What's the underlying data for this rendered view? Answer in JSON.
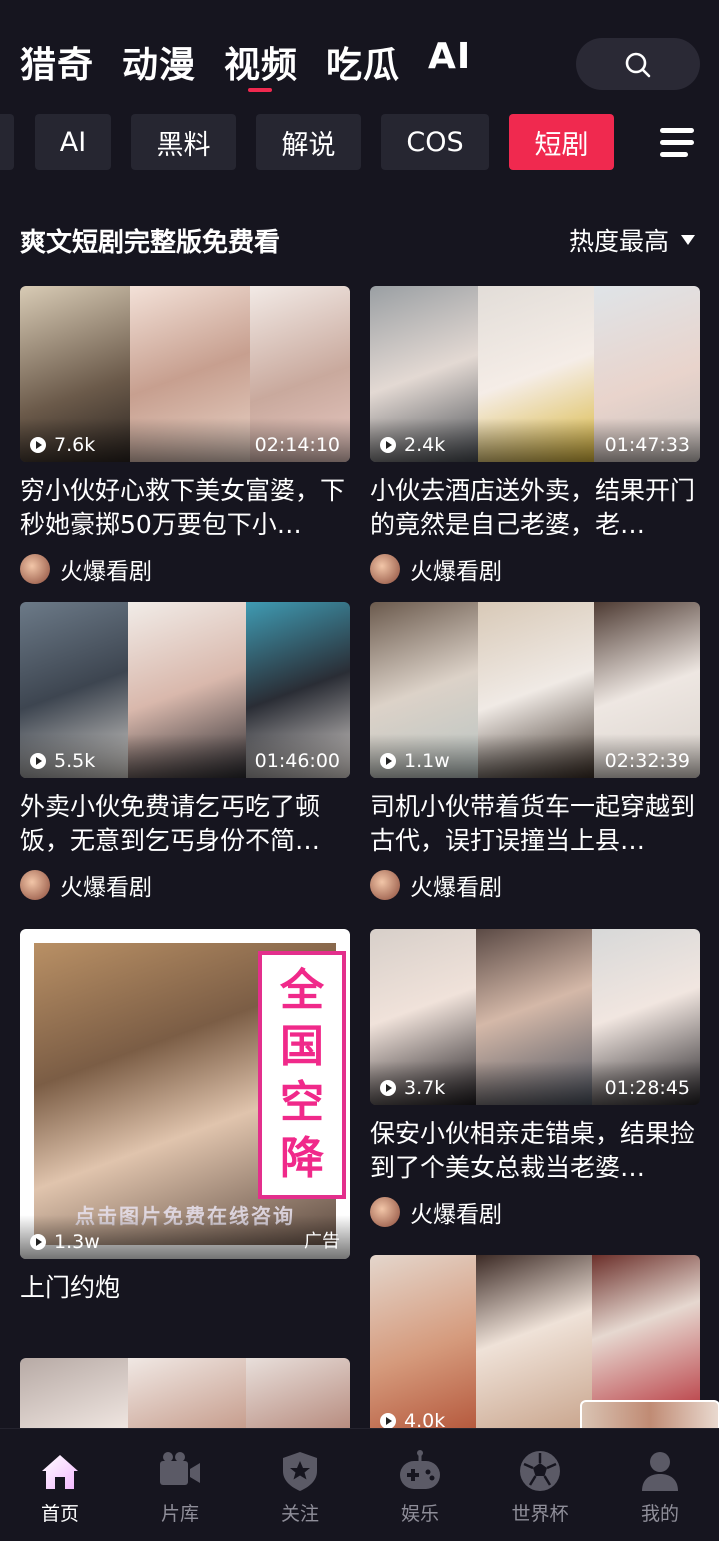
{
  "top_tabs": [
    "猎奇",
    "动漫",
    "视频",
    "吃瓜",
    "AI"
  ],
  "active_top_tab": "视频",
  "categories": [
    "AI",
    "黑料",
    "解说",
    "COS",
    "短剧"
  ],
  "active_category": "短剧",
  "section": {
    "title": "爽文短剧完整版免费看",
    "sort_label": "热度最高"
  },
  "cards": [
    {
      "views": "7.6k",
      "duration": "02:14:10",
      "title": "穷小伙好心救下美女富婆，下秒她豪掷50万要包下小…",
      "author": "火爆看剧"
    },
    {
      "views": "2.4k",
      "duration": "01:47:33",
      "title": "小伙去酒店送外卖，结果开门的竟然是自己老婆，老…",
      "author": "火爆看剧"
    },
    {
      "views": "5.5k",
      "duration": "01:46:00",
      "title": "外卖小伙免费请乞丐吃了顿饭，无意到乞丐身份不简…",
      "author": "火爆看剧"
    },
    {
      "views": "1.1w",
      "duration": "02:32:39",
      "title": "司机小伙带着货车一起穿越到古代，误打误撞当上县…",
      "author": "火爆看剧"
    },
    {
      "views": "3.7k",
      "duration": "01:28:45",
      "title": "保安小伙相亲走错桌，结果捡到了个美女总裁当老婆…",
      "author": "火爆看剧"
    },
    {
      "views": "4.0k"
    }
  ],
  "ad_card": {
    "views": "1.3w",
    "tag": "广告",
    "title": "上门约炮",
    "banner_vertical": [
      "全",
      "国",
      "空",
      "降"
    ],
    "banner_horizontal": "点击图片免费在线咨询"
  },
  "bottom_nav": [
    {
      "label": "首页",
      "icon": "home-icon"
    },
    {
      "label": "片库",
      "icon": "video-camera-icon"
    },
    {
      "label": "关注",
      "icon": "shield-star-icon"
    },
    {
      "label": "娱乐",
      "icon": "gamepad-icon"
    },
    {
      "label": "世界杯",
      "icon": "soccer-ball-icon"
    },
    {
      "label": "我的",
      "icon": "user-icon"
    }
  ],
  "active_nav": "首页",
  "colors": {
    "accent": "#f0294f",
    "background": "#16151f",
    "chip": "#262631"
  }
}
